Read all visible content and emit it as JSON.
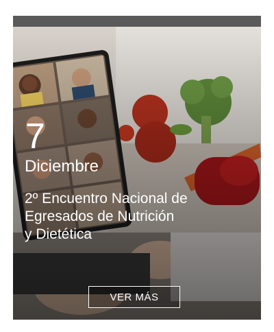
{
  "event": {
    "day": "7",
    "month": "Diciembre",
    "title_lines": [
      "2º Encuentro Nacional de",
      "Egresados de Nutrición",
      "y Dietética"
    ],
    "cta_label": "VER MÁS"
  },
  "colors": {
    "topbar": "#5a5a5a",
    "text": "#ffffff",
    "button_border": "#ffffff"
  }
}
